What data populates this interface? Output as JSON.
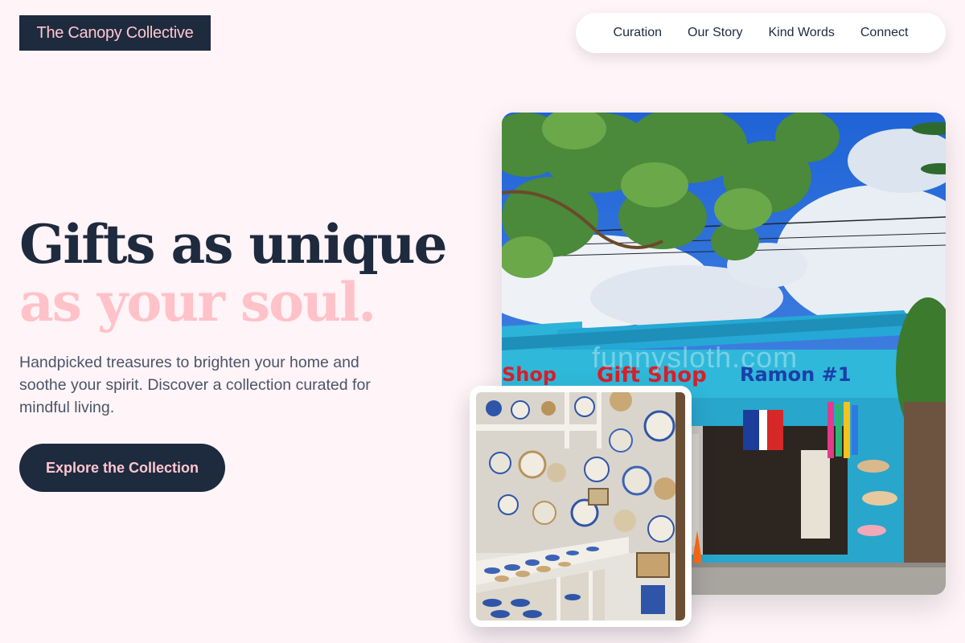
{
  "brand": {
    "name": "The Canopy Collective"
  },
  "nav": {
    "items": [
      {
        "label": "Curation"
      },
      {
        "label": "Our Story"
      },
      {
        "label": "Kind Words"
      },
      {
        "label": "Connect"
      }
    ]
  },
  "hero": {
    "headline_line1": "Gifts as unique",
    "headline_line2": "as your soul.",
    "subtext": "Handpicked treasures to brighten your home and soothe your spirit. Discover a collection curated for mindful living.",
    "cta_label": "Explore the Collection"
  },
  "images": {
    "main": {
      "watermark": "funnysloth.com",
      "sign_left": "Shop",
      "sign_gift": "Gift Shop",
      "sign_ramon": "Ramon #1"
    }
  },
  "colors": {
    "background": "#fff4f7",
    "navy": "#1e2a3e",
    "pink": "#ffc2c9",
    "body_text": "#4a5568"
  }
}
